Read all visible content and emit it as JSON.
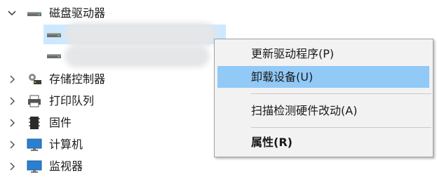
{
  "device_manager": {
    "disk_drives": {
      "label": "磁盘驱动器",
      "expanded": true,
      "icon": "disk-drive-icon"
    },
    "categories": [
      {
        "label": "存储控制器",
        "icon": "storage-controller-icon"
      },
      {
        "label": "打印队列",
        "icon": "printer-icon"
      },
      {
        "label": "固件",
        "icon": "firmware-chip-icon"
      },
      {
        "label": "计算机",
        "icon": "monitor-icon"
      },
      {
        "label": "监视器",
        "icon": "monitor-icon"
      }
    ]
  },
  "context_menu": {
    "items": [
      {
        "label": "更新驱动程序(P)",
        "highlighted": false,
        "bold": false
      },
      {
        "label": "卸载设备(U)",
        "highlighted": true,
        "bold": false
      },
      {
        "label": "扫描检测硬件改动(A)",
        "highlighted": false,
        "bold": false
      },
      {
        "label": "属性(R)",
        "highlighted": false,
        "bold": true
      }
    ]
  },
  "colors": {
    "highlight": "#91c9f7",
    "menu_background": "#f2f2f2",
    "selected_row": "#cce8ff",
    "blur": "#e4e6e8"
  }
}
